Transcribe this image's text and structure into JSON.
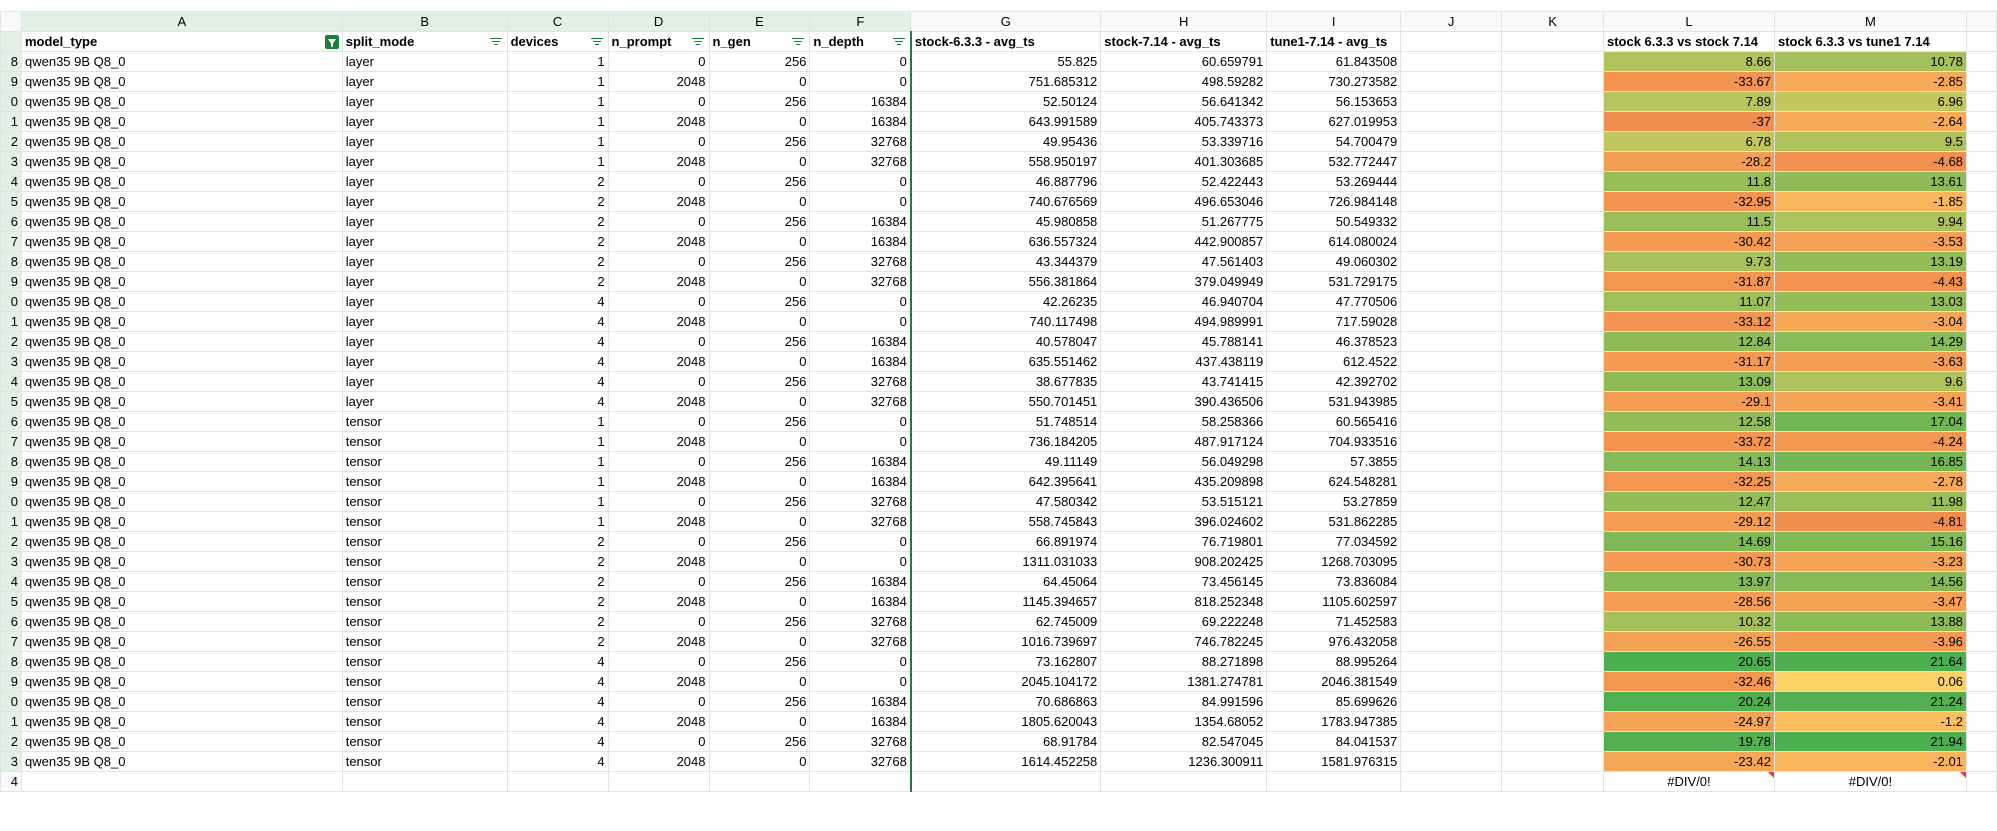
{
  "column_letters": [
    "A",
    "B",
    "C",
    "D",
    "E",
    "F",
    "G",
    "H",
    "I",
    "J",
    "K",
    "L",
    "M"
  ],
  "headers": {
    "model_type": "model_type",
    "split_mode": "split_mode",
    "devices": "devices",
    "n_prompt": "n_prompt",
    "n_gen": "n_gen",
    "n_depth": "n_depth",
    "stock633": "stock-6.3.3 - avg_ts",
    "stock714": "stock-7.14 - avg_ts",
    "tune1": "tune1-7.14 - avg_ts",
    "j": "",
    "k": "",
    "cmp_l": "stock 6.3.3 vs stock 7.14",
    "cmp_m": "stock 6.3.3 vs tune1 7.14"
  },
  "header_row_number": "",
  "rows": [
    {
      "rn": "8",
      "model": "qwen35 9B Q8_0",
      "split": "layer",
      "devices": "1",
      "n_prompt": "0",
      "n_gen": "256",
      "n_depth": "0",
      "g": "55.825",
      "h": "60.659791",
      "i": "61.843508",
      "l": "8.66",
      "m": "10.78"
    },
    {
      "rn": "9",
      "model": "qwen35 9B Q8_0",
      "split": "layer",
      "devices": "1",
      "n_prompt": "2048",
      "n_gen": "0",
      "n_depth": "0",
      "g": "751.685312",
      "h": "498.59282",
      "i": "730.273582",
      "l": "-33.67",
      "m": "-2.85"
    },
    {
      "rn": "0",
      "model": "qwen35 9B Q8_0",
      "split": "layer",
      "devices": "1",
      "n_prompt": "0",
      "n_gen": "256",
      "n_depth": "16384",
      "g": "52.50124",
      "h": "56.641342",
      "i": "56.153653",
      "l": "7.89",
      "m": "6.96"
    },
    {
      "rn": "1",
      "model": "qwen35 9B Q8_0",
      "split": "layer",
      "devices": "1",
      "n_prompt": "2048",
      "n_gen": "0",
      "n_depth": "16384",
      "g": "643.991589",
      "h": "405.743373",
      "i": "627.019953",
      "l": "-37",
      "m": "-2.64"
    },
    {
      "rn": "2",
      "model": "qwen35 9B Q8_0",
      "split": "layer",
      "devices": "1",
      "n_prompt": "0",
      "n_gen": "256",
      "n_depth": "32768",
      "g": "49.95436",
      "h": "53.339716",
      "i": "54.700479",
      "l": "6.78",
      "m": "9.5"
    },
    {
      "rn": "3",
      "model": "qwen35 9B Q8_0",
      "split": "layer",
      "devices": "1",
      "n_prompt": "2048",
      "n_gen": "0",
      "n_depth": "32768",
      "g": "558.950197",
      "h": "401.303685",
      "i": "532.772447",
      "l": "-28.2",
      "m": "-4.68"
    },
    {
      "rn": "4",
      "model": "qwen35 9B Q8_0",
      "split": "layer",
      "devices": "2",
      "n_prompt": "0",
      "n_gen": "256",
      "n_depth": "0",
      "g": "46.887796",
      "h": "52.422443",
      "i": "53.269444",
      "l": "11.8",
      "m": "13.61"
    },
    {
      "rn": "5",
      "model": "qwen35 9B Q8_0",
      "split": "layer",
      "devices": "2",
      "n_prompt": "2048",
      "n_gen": "0",
      "n_depth": "0",
      "g": "740.676569",
      "h": "496.653046",
      "i": "726.984148",
      "l": "-32.95",
      "m": "-1.85"
    },
    {
      "rn": "6",
      "model": "qwen35 9B Q8_0",
      "split": "layer",
      "devices": "2",
      "n_prompt": "0",
      "n_gen": "256",
      "n_depth": "16384",
      "g": "45.980858",
      "h": "51.267775",
      "i": "50.549332",
      "l": "11.5",
      "m": "9.94"
    },
    {
      "rn": "7",
      "model": "qwen35 9B Q8_0",
      "split": "layer",
      "devices": "2",
      "n_prompt": "2048",
      "n_gen": "0",
      "n_depth": "16384",
      "g": "636.557324",
      "h": "442.900857",
      "i": "614.080024",
      "l": "-30.42",
      "m": "-3.53"
    },
    {
      "rn": "8",
      "model": "qwen35 9B Q8_0",
      "split": "layer",
      "devices": "2",
      "n_prompt": "0",
      "n_gen": "256",
      "n_depth": "32768",
      "g": "43.344379",
      "h": "47.561403",
      "i": "49.060302",
      "l": "9.73",
      "m": "13.19"
    },
    {
      "rn": "9",
      "model": "qwen35 9B Q8_0",
      "split": "layer",
      "devices": "2",
      "n_prompt": "2048",
      "n_gen": "0",
      "n_depth": "32768",
      "g": "556.381864",
      "h": "379.049949",
      "i": "531.729175",
      "l": "-31.87",
      "m": "-4.43"
    },
    {
      "rn": "0",
      "model": "qwen35 9B Q8_0",
      "split": "layer",
      "devices": "4",
      "n_prompt": "0",
      "n_gen": "256",
      "n_depth": "0",
      "g": "42.26235",
      "h": "46.940704",
      "i": "47.770506",
      "l": "11.07",
      "m": "13.03"
    },
    {
      "rn": "1",
      "model": "qwen35 9B Q8_0",
      "split": "layer",
      "devices": "4",
      "n_prompt": "2048",
      "n_gen": "0",
      "n_depth": "0",
      "g": "740.117498",
      "h": "494.989991",
      "i": "717.59028",
      "l": "-33.12",
      "m": "-3.04"
    },
    {
      "rn": "2",
      "model": "qwen35 9B Q8_0",
      "split": "layer",
      "devices": "4",
      "n_prompt": "0",
      "n_gen": "256",
      "n_depth": "16384",
      "g": "40.578047",
      "h": "45.788141",
      "i": "46.378523",
      "l": "12.84",
      "m": "14.29"
    },
    {
      "rn": "3",
      "model": "qwen35 9B Q8_0",
      "split": "layer",
      "devices": "4",
      "n_prompt": "2048",
      "n_gen": "0",
      "n_depth": "16384",
      "g": "635.551462",
      "h": "437.438119",
      "i": "612.4522",
      "l": "-31.17",
      "m": "-3.63"
    },
    {
      "rn": "4",
      "model": "qwen35 9B Q8_0",
      "split": "layer",
      "devices": "4",
      "n_prompt": "0",
      "n_gen": "256",
      "n_depth": "32768",
      "g": "38.677835",
      "h": "43.741415",
      "i": "42.392702",
      "l": "13.09",
      "m": "9.6"
    },
    {
      "rn": "5",
      "model": "qwen35 9B Q8_0",
      "split": "layer",
      "devices": "4",
      "n_prompt": "2048",
      "n_gen": "0",
      "n_depth": "32768",
      "g": "550.701451",
      "h": "390.436506",
      "i": "531.943985",
      "l": "-29.1",
      "m": "-3.41"
    },
    {
      "rn": "6",
      "model": "qwen35 9B Q8_0",
      "split": "tensor",
      "devices": "1",
      "n_prompt": "0",
      "n_gen": "256",
      "n_depth": "0",
      "g": "51.748514",
      "h": "58.258366",
      "i": "60.565416",
      "l": "12.58",
      "m": "17.04"
    },
    {
      "rn": "7",
      "model": "qwen35 9B Q8_0",
      "split": "tensor",
      "devices": "1",
      "n_prompt": "2048",
      "n_gen": "0",
      "n_depth": "0",
      "g": "736.184205",
      "h": "487.917124",
      "i": "704.933516",
      "l": "-33.72",
      "m": "-4.24"
    },
    {
      "rn": "8",
      "model": "qwen35 9B Q8_0",
      "split": "tensor",
      "devices": "1",
      "n_prompt": "0",
      "n_gen": "256",
      "n_depth": "16384",
      "g": "49.11149",
      "h": "56.049298",
      "i": "57.3855",
      "l": "14.13",
      "m": "16.85"
    },
    {
      "rn": "9",
      "model": "qwen35 9B Q8_0",
      "split": "tensor",
      "devices": "1",
      "n_prompt": "2048",
      "n_gen": "0",
      "n_depth": "16384",
      "g": "642.395641",
      "h": "435.209898",
      "i": "624.548281",
      "l": "-32.25",
      "m": "-2.78"
    },
    {
      "rn": "0",
      "model": "qwen35 9B Q8_0",
      "split": "tensor",
      "devices": "1",
      "n_prompt": "0",
      "n_gen": "256",
      "n_depth": "32768",
      "g": "47.580342",
      "h": "53.515121",
      "i": "53.27859",
      "l": "12.47",
      "m": "11.98"
    },
    {
      "rn": "1",
      "model": "qwen35 9B Q8_0",
      "split": "tensor",
      "devices": "1",
      "n_prompt": "2048",
      "n_gen": "0",
      "n_depth": "32768",
      "g": "558.745843",
      "h": "396.024602",
      "i": "531.862285",
      "l": "-29.12",
      "m": "-4.81"
    },
    {
      "rn": "2",
      "model": "qwen35 9B Q8_0",
      "split": "tensor",
      "devices": "2",
      "n_prompt": "0",
      "n_gen": "256",
      "n_depth": "0",
      "g": "66.891974",
      "h": "76.719801",
      "i": "77.034592",
      "l": "14.69",
      "m": "15.16"
    },
    {
      "rn": "3",
      "model": "qwen35 9B Q8_0",
      "split": "tensor",
      "devices": "2",
      "n_prompt": "2048",
      "n_gen": "0",
      "n_depth": "0",
      "g": "1311.031033",
      "h": "908.202425",
      "i": "1268.703095",
      "l": "-30.73",
      "m": "-3.23"
    },
    {
      "rn": "4",
      "model": "qwen35 9B Q8_0",
      "split": "tensor",
      "devices": "2",
      "n_prompt": "0",
      "n_gen": "256",
      "n_depth": "16384",
      "g": "64.45064",
      "h": "73.456145",
      "i": "73.836084",
      "l": "13.97",
      "m": "14.56"
    },
    {
      "rn": "5",
      "model": "qwen35 9B Q8_0",
      "split": "tensor",
      "devices": "2",
      "n_prompt": "2048",
      "n_gen": "0",
      "n_depth": "16384",
      "g": "1145.394657",
      "h": "818.252348",
      "i": "1105.602597",
      "l": "-28.56",
      "m": "-3.47"
    },
    {
      "rn": "6",
      "model": "qwen35 9B Q8_0",
      "split": "tensor",
      "devices": "2",
      "n_prompt": "0",
      "n_gen": "256",
      "n_depth": "32768",
      "g": "62.745009",
      "h": "69.222248",
      "i": "71.452583",
      "l": "10.32",
      "m": "13.88"
    },
    {
      "rn": "7",
      "model": "qwen35 9B Q8_0",
      "split": "tensor",
      "devices": "2",
      "n_prompt": "2048",
      "n_gen": "0",
      "n_depth": "32768",
      "g": "1016.739697",
      "h": "746.782245",
      "i": "976.432058",
      "l": "-26.55",
      "m": "-3.96"
    },
    {
      "rn": "8",
      "model": "qwen35 9B Q8_0",
      "split": "tensor",
      "devices": "4",
      "n_prompt": "0",
      "n_gen": "256",
      "n_depth": "0",
      "g": "73.162807",
      "h": "88.271898",
      "i": "88.995264",
      "l": "20.65",
      "m": "21.64"
    },
    {
      "rn": "9",
      "model": "qwen35 9B Q8_0",
      "split": "tensor",
      "devices": "4",
      "n_prompt": "2048",
      "n_gen": "0",
      "n_depth": "0",
      "g": "2045.104172",
      "h": "1381.274781",
      "i": "2046.381549",
      "l": "-32.46",
      "m": "0.06"
    },
    {
      "rn": "0",
      "model": "qwen35 9B Q8_0",
      "split": "tensor",
      "devices": "4",
      "n_prompt": "0",
      "n_gen": "256",
      "n_depth": "16384",
      "g": "70.686863",
      "h": "84.991596",
      "i": "85.699626",
      "l": "20.24",
      "m": "21.24"
    },
    {
      "rn": "1",
      "model": "qwen35 9B Q8_0",
      "split": "tensor",
      "devices": "4",
      "n_prompt": "2048",
      "n_gen": "0",
      "n_depth": "16384",
      "g": "1805.620043",
      "h": "1354.68052",
      "i": "1783.947385",
      "l": "-24.97",
      "m": "-1.2"
    },
    {
      "rn": "2",
      "model": "qwen35 9B Q8_0",
      "split": "tensor",
      "devices": "4",
      "n_prompt": "0",
      "n_gen": "256",
      "n_depth": "32768",
      "g": "68.91784",
      "h": "82.547045",
      "i": "84.041537",
      "l": "19.78",
      "m": "21.94"
    },
    {
      "rn": "3",
      "model": "qwen35 9B Q8_0",
      "split": "tensor",
      "devices": "4",
      "n_prompt": "2048",
      "n_gen": "0",
      "n_depth": "32768",
      "g": "1614.452258",
      "h": "1236.300911",
      "i": "1581.976315",
      "l": "-23.42",
      "m": "-2.01"
    }
  ],
  "footer": {
    "rn": "4",
    "l": "#DIV/0!",
    "m": "#DIV/0!"
  },
  "colors": {
    "header_bg": "#f8f9fa",
    "selected_header_bg": "#e1f1e4",
    "filter_green": "#188038",
    "scale_min": "#f28e4d",
    "scale_mid": "#fcd166",
    "scale_max": "#4caf50",
    "error_flag": "#e53935"
  }
}
